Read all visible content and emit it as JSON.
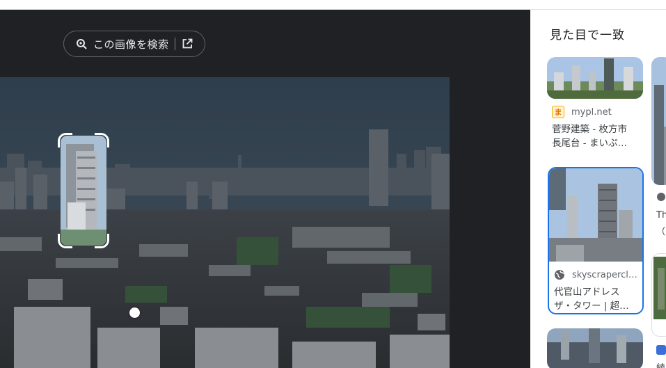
{
  "viewer": {
    "search_chip_label": "この画像を検索"
  },
  "results": {
    "heading": "見た目で一致",
    "cards": [
      {
        "favicon_text": "ま",
        "favicon_color": "#f9ab00",
        "source": "mypl.net",
        "title": "菅野建築 - 枚方市 長尾台 - まいぷ…"
      },
      {
        "favicon_icon": "globe-icon",
        "source": "skyscrapercl…",
        "title": "代官山アドレス ザ・タワー | 超高…"
      }
    ],
    "peek": [
      {
        "text1": "Th",
        "text2": "（"
      },
      {
        "text1": "綾"
      }
    ]
  },
  "colors": {
    "viewer_bg": "#202124",
    "selected_border": "#1a73e8",
    "chip_border": "#5f6368"
  }
}
